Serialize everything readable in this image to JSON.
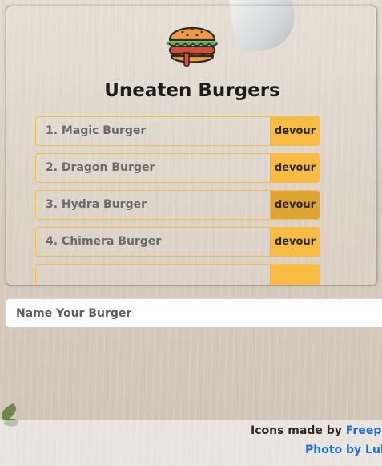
{
  "app": {
    "title": "Uneaten Burgers",
    "logo_icon": "burger-icon"
  },
  "burgers": [
    {
      "label": "1. Magic Burger",
      "action": "devour"
    },
    {
      "label": "2. Dragon Burger",
      "action": "devour"
    },
    {
      "label": "3. Hydra Burger",
      "action": "devour"
    },
    {
      "label": "4. Chimera Burger",
      "action": "devour"
    },
    {
      "label": "",
      "action": ""
    }
  ],
  "form": {
    "placeholder": "Name Your Burger",
    "value": ""
  },
  "footer": {
    "icons_prefix": "Icons made by ",
    "icons_link": "Freepik",
    "photo_link": "Photo by Luk"
  },
  "colors": {
    "accent": "#f7bc41",
    "accent_hover": "#dfa432",
    "link": "#1a6fe0"
  }
}
